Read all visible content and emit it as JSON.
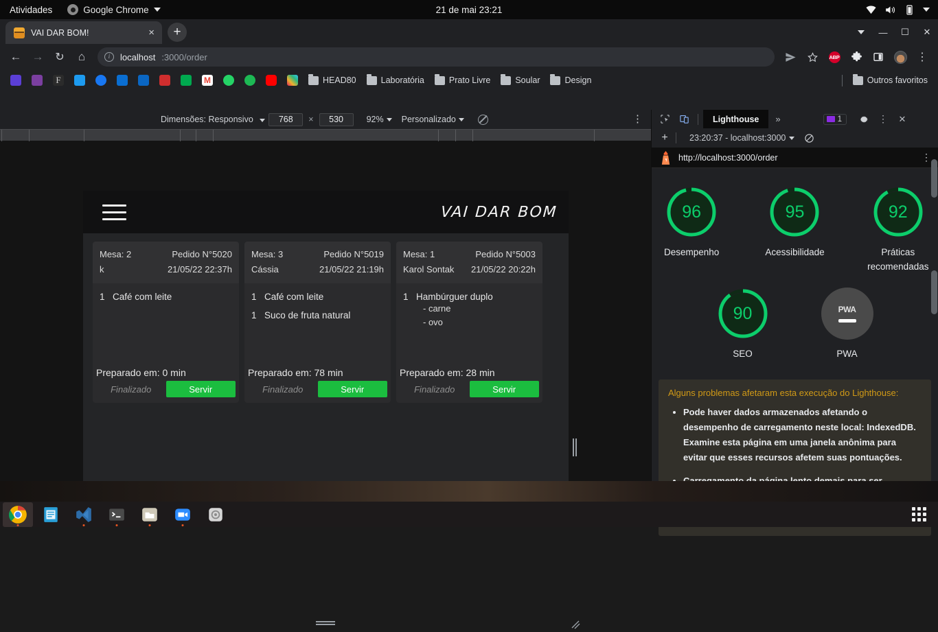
{
  "gnome": {
    "activities": "Atividades",
    "app_name": "Google Chrome",
    "clock": "21 de mai  23:21",
    "icons": [
      "wifi-icon",
      "volume-icon",
      "battery-icon",
      "caret-down-icon"
    ]
  },
  "chrome": {
    "tab": {
      "title": "VAI DAR BOM!",
      "favicon": "burger-icon",
      "close": "×"
    },
    "newtab_label": "+",
    "window_controls": {
      "minimize": "—",
      "maximize": "☐",
      "close": "✕"
    },
    "nav": {
      "back": "←",
      "forward": "→",
      "reload": "↻",
      "home": "⌂"
    },
    "omnibox": {
      "url_host": "localhost",
      "url_path": ":3000/order",
      "share_icon": "share-icon",
      "star_icon": "bookmark-star-icon"
    },
    "extensions": [
      {
        "name": "abp-icon",
        "label": "ABP"
      },
      {
        "name": "puzzle-icon",
        "label": ""
      },
      {
        "name": "sidepanel-icon",
        "label": ""
      }
    ],
    "profile": "avatar",
    "menu": "⋮",
    "bookmarks": [
      {
        "label": "",
        "icon": "grammarly-icon",
        "color": "#5b3fd6"
      },
      {
        "label": "",
        "icon": "figma-community-icon",
        "color": "#7b3fa0"
      },
      {
        "label": "",
        "icon": "f-serif-icon",
        "color": "#c9c9c9"
      },
      {
        "label": "",
        "icon": "twitter-icon",
        "color": "#1d9bf0"
      },
      {
        "label": "",
        "icon": "facebook-icon",
        "color": "#1877f2"
      },
      {
        "label": "",
        "icon": "outlook-icon",
        "color": "#0a6ed1"
      },
      {
        "label": "",
        "icon": "linkedin-icon",
        "color": "#0a66c2"
      },
      {
        "label": "",
        "icon": "behance-icon",
        "color": "#cf2e2e"
      },
      {
        "label": "",
        "icon": "meet-icon",
        "color": "#00a94f"
      },
      {
        "label": "",
        "icon": "gmail-icon",
        "color": "#ea4335"
      },
      {
        "label": "",
        "icon": "whatsapp-icon",
        "color": "#25d366"
      },
      {
        "label": "",
        "icon": "spotify-icon",
        "color": "#1db954"
      },
      {
        "label": "",
        "icon": "youtube-icon",
        "color": "#ff0000"
      },
      {
        "label": "",
        "icon": "slack-icon",
        "color": "#e01e5a"
      }
    ],
    "bookmark_folders": [
      "HEAD80",
      "Laboratória",
      "Prato Livre",
      "Soular",
      "Design"
    ],
    "other_bookmarks": "Outros favoritos"
  },
  "devtools": {
    "device_toolbar": {
      "dimensions_label": "Dimensões: Responsivo",
      "width": "768",
      "height": "530",
      "x_separator": "×",
      "zoom": "92%",
      "throttle": "Personalizado",
      "rotate_icon": "no-throttle-icon",
      "menu": "⋮"
    },
    "panel_tabs": {
      "inspect_icon": "inspect-cursor-icon",
      "device_icon": "device-toggle-icon",
      "active_tab": "Lighthouse",
      "more_tabs": "»",
      "issues_count": "1",
      "settings_icon": "gear-icon",
      "menu_icon": "⋮",
      "close_icon": "✕"
    },
    "lighthouse_toolbar": {
      "add": "+",
      "run_selector": "23:20:37 - localhost:3000",
      "clear_icon": "no-entry-icon"
    },
    "report": {
      "url": "http://localhost:3000/order",
      "logo": "lighthouse-icon",
      "menu": "⋮",
      "gauges": [
        {
          "label": "Desempenho",
          "score": 96
        },
        {
          "label": "Acessibilidade",
          "score": 95
        },
        {
          "label": "Práticas recomendadas",
          "score": 92
        },
        {
          "label": "SEO",
          "score": 90
        },
        {
          "label": "PWA",
          "score": null,
          "badge": "PWA"
        }
      ],
      "warning_title": "Alguns problemas afetaram esta execução do Lighthouse:",
      "warnings": [
        "Pode haver dados armazenados afetando o desempenho de carregamento neste local: IndexedDB. Examine esta página em uma janela anônima para evitar que esses recursos afetem suas pontuações.",
        "Carregamento da página lento demais para ser concluído dentro do limite de tempo. Os"
      ]
    }
  },
  "app": {
    "brand": "VAI DAR BOM",
    "menu_icon": "hamburger-menu-icon",
    "labels": {
      "table_prefix": "Mesa:",
      "order_prefix": "Pedido N°",
      "prepared_prefix": "Preparado em:",
      "minutes_suffix": "min",
      "finalized": "Finalizado",
      "serve": "Servir"
    },
    "orders": [
      {
        "table": "Mesa: 2",
        "order_no": "Pedido N°5020",
        "customer": "k",
        "datetime": "21/05/22 22:37h",
        "items": [
          {
            "qty": "1",
            "name": "Café com leite",
            "extras": []
          }
        ],
        "prepared": "Preparado em: 0 min",
        "finalized_label": "Finalizado",
        "serve_label": "Servir"
      },
      {
        "table": "Mesa: 3",
        "order_no": "Pedido N°5019",
        "customer": "Cássia",
        "datetime": "21/05/22 21:19h",
        "items": [
          {
            "qty": "1",
            "name": "Café com leite",
            "extras": []
          },
          {
            "qty": "1",
            "name": "Suco de fruta natural",
            "extras": []
          }
        ],
        "prepared": "Preparado em: 78 min",
        "finalized_label": "Finalizado",
        "serve_label": "Servir"
      },
      {
        "table": "Mesa: 1",
        "order_no": "Pedido N°5003",
        "customer": "Karol Sontak",
        "datetime": "21/05/22 20:22h",
        "items": [
          {
            "qty": "1",
            "name": "Hambúrguer duplo",
            "extras": [
              "- carne",
              "- ovo"
            ]
          }
        ],
        "prepared": "Preparado em: 28 min",
        "finalized_label": "Finalizado",
        "serve_label": "Servir"
      }
    ]
  },
  "dock": {
    "items": [
      {
        "name": "chrome-icon",
        "active": true
      },
      {
        "name": "libreoffice-writer-icon",
        "active": false
      },
      {
        "name": "vscode-icon",
        "active": false
      },
      {
        "name": "terminal-icon",
        "active": false
      },
      {
        "name": "files-icon",
        "active": false
      },
      {
        "name": "zoom-icon",
        "active": false
      },
      {
        "name": "settings-icon",
        "active": false
      }
    ],
    "show_apps": "show-applications-icon"
  },
  "colors": {
    "accent_green": "#1bbd3f",
    "lighthouse_green": "#0cce6b",
    "warning_amber": "#d19a16",
    "chrome_bg": "#202124"
  }
}
